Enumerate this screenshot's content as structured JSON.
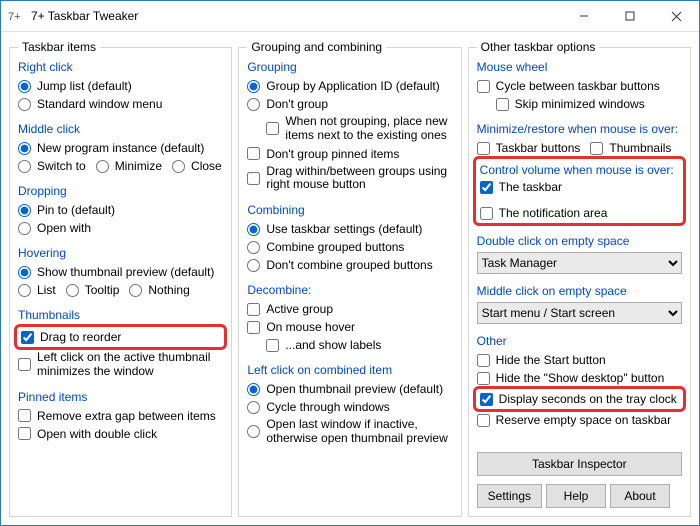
{
  "window": {
    "title": "7+ Taskbar Tweaker"
  },
  "columns": {
    "left": {
      "legend": "Taskbar items"
    },
    "middle": {
      "legend": "Grouping and combining"
    },
    "right": {
      "legend": "Other taskbar options"
    }
  },
  "left": {
    "right_click": {
      "label": "Right click",
      "jump_list": "Jump list (default)",
      "standard_menu": "Standard window menu"
    },
    "middle_click": {
      "label": "Middle click",
      "new_instance": "New program instance (default)",
      "switch_to": "Switch to",
      "minimize": "Minimize",
      "close": "Close"
    },
    "dropping": {
      "label": "Dropping",
      "pin_to": "Pin to (default)",
      "open_with": "Open with"
    },
    "hovering": {
      "label": "Hovering",
      "show_thumb": "Show thumbnail preview (default)",
      "list": "List",
      "tooltip": "Tooltip",
      "nothing": "Nothing"
    },
    "thumbnails": {
      "label": "Thumbnails",
      "drag_reorder": "Drag to reorder",
      "left_click_active": "Left click on the active thumbnail minimizes the window"
    },
    "pinned": {
      "label": "Pinned items",
      "remove_gap": "Remove extra gap between items",
      "open_dbl": "Open with double click"
    }
  },
  "middle": {
    "grouping": {
      "label": "Grouping",
      "by_app_id": "Group by Application ID (default)",
      "dont_group": "Don't group",
      "place_next": "When not grouping, place new items next to the existing ones",
      "dont_group_pinned": "Don't group pinned items",
      "drag_rmb": "Drag within/between groups using right mouse button"
    },
    "combining": {
      "label": "Combining",
      "use_settings": "Use taskbar settings (default)",
      "combine": "Combine grouped buttons",
      "dont_combine": "Don't combine grouped buttons"
    },
    "decombine": {
      "label": "Decombine:",
      "active_group": "Active group",
      "on_hover": "On mouse hover",
      "show_labels": "...and show labels"
    },
    "left_combined": {
      "label": "Left click on combined item",
      "open_thumb": "Open thumbnail preview (default)",
      "cycle": "Cycle through windows",
      "open_last": "Open last window if inactive, otherwise open thumbnail preview"
    }
  },
  "right": {
    "mouse_wheel": {
      "label": "Mouse wheel",
      "cycle": "Cycle between taskbar buttons",
      "skip_min": "Skip minimized windows"
    },
    "min_restore": {
      "label": "Minimize/restore when mouse is over:",
      "taskbar_buttons": "Taskbar buttons",
      "thumbnails": "Thumbnails"
    },
    "ctrl_volume": {
      "label": "Control volume when mouse is over:",
      "the_taskbar": "The taskbar",
      "notif_area": "The notification area"
    },
    "dbl_empty": {
      "label": "Double click on empty space",
      "value": "Task Manager"
    },
    "mid_empty": {
      "label": "Middle click on empty space",
      "value": "Start menu / Start screen"
    },
    "other": {
      "label": "Other",
      "hide_start": "Hide the Start button",
      "hide_showdesktop": "Hide the \"Show desktop\" button",
      "display_seconds": "Display seconds on the tray clock",
      "reserve_empty": "Reserve empty space on taskbar"
    },
    "buttons": {
      "inspector": "Taskbar Inspector",
      "settings": "Settings",
      "help": "Help",
      "about": "About"
    }
  },
  "state": {
    "left": {
      "right_click": "jump_list",
      "middle_click": "new_instance",
      "dropping": "pin_to",
      "hovering": "show_thumb",
      "drag_reorder": true,
      "left_click_active": false,
      "remove_gap": false,
      "open_dbl": false
    },
    "middle": {
      "grouping": "by_app_id",
      "place_next": false,
      "dont_group_pinned": false,
      "drag_rmb": false,
      "combining": "use_settings",
      "active_group": false,
      "on_hover": false,
      "show_labels": false,
      "left_combined": "open_thumb"
    },
    "right": {
      "cycle": false,
      "skip_min": false,
      "taskbar_buttons": false,
      "thumbnails": false,
      "the_taskbar": true,
      "notif_area": false,
      "hide_start": false,
      "hide_showdesktop": false,
      "display_seconds": true,
      "reserve_empty": false
    }
  }
}
